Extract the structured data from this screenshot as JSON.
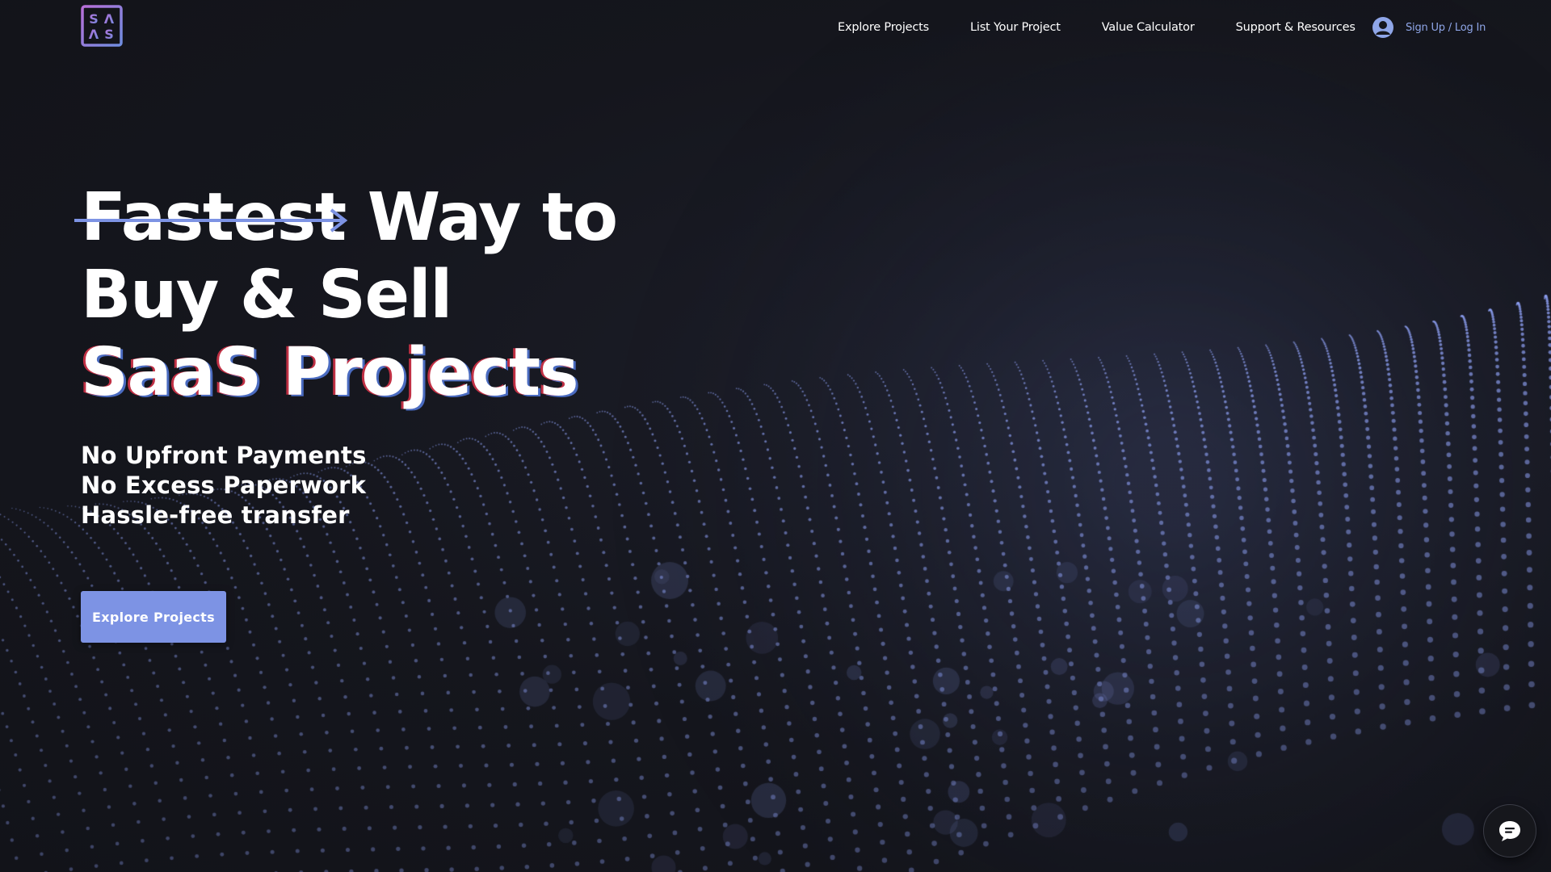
{
  "brand": {
    "logo_letters": [
      "S",
      "Λ",
      "Λ",
      "S"
    ],
    "logo_text": "SAAS",
    "gradient_from": "#b86fd8",
    "gradient_to": "#6f8de0"
  },
  "nav": {
    "items": [
      {
        "label": "Explore Projects"
      },
      {
        "label": "List Your Project"
      },
      {
        "label": "Value Calculator"
      },
      {
        "label": "Support & Resources"
      }
    ],
    "login_label": "Sign Up / Log In",
    "login_icon": "user-avatar-icon"
  },
  "hero": {
    "line1_strike": "Fastest",
    "line1_rest": " Way to",
    "line2": "Buy & Sell",
    "line3": "SaaS Projects",
    "benefits": [
      "No Upfront Payments",
      "No Excess Paperwork",
      "Hassle-free transfer"
    ],
    "cta_label": "Explore Projects"
  },
  "chat": {
    "icon": "chat-bubble-icon"
  },
  "colors": {
    "background": "#15161d",
    "accent": "#7d93e4",
    "link": "#8fa6e8",
    "dots": "#8c9ef0"
  }
}
